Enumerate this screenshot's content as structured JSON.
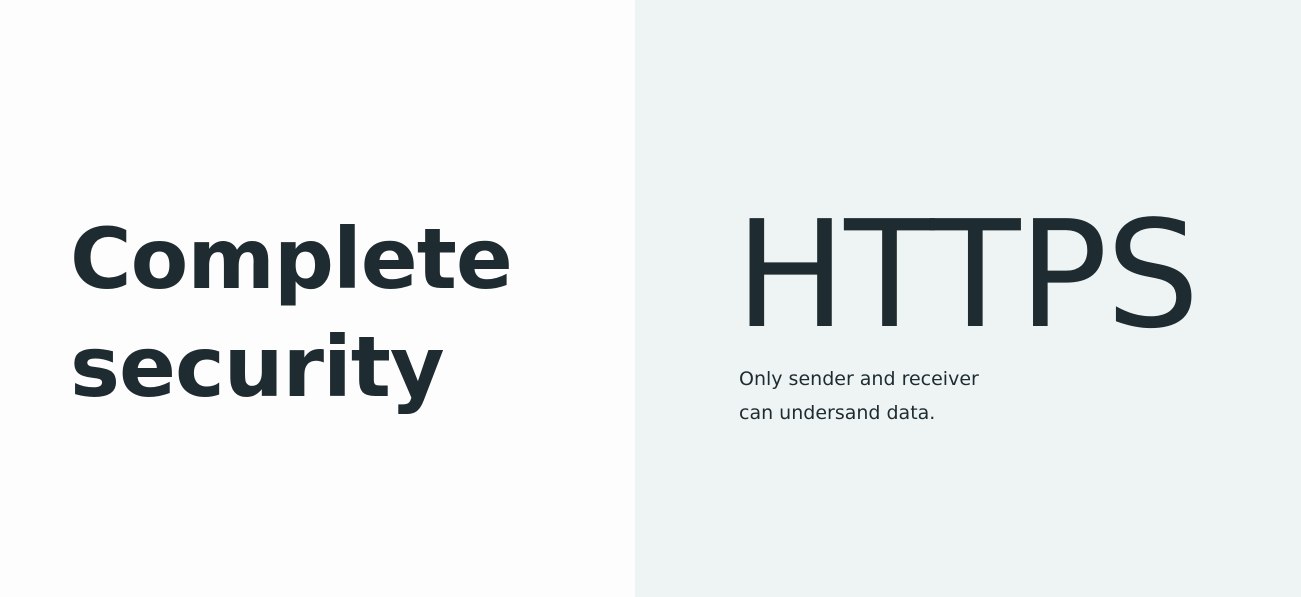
{
  "left_panel": {
    "headline_line1": "Complete",
    "headline_line2": "security"
  },
  "right_panel": {
    "term": "HTTPS",
    "caption_line1": "Only sender and receiver",
    "caption_line2": "can undersand data."
  },
  "colors": {
    "text": "#1e2b30",
    "left_background": "#fdfdfd",
    "right_background": "#eef4f4"
  }
}
